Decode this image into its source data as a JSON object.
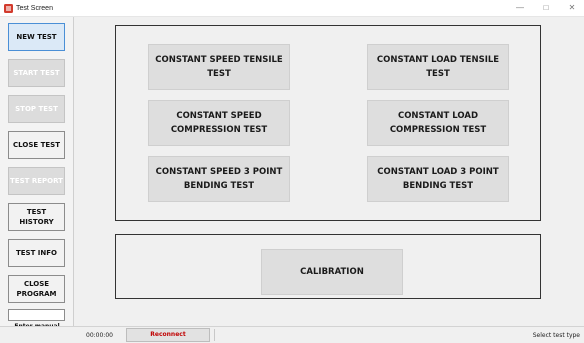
{
  "window": {
    "title": "Test Screen",
    "minimize": "—",
    "maximize": "□",
    "close": "✕"
  },
  "sidebar": {
    "new_test": "NEW TEST",
    "start_test": "START TEST",
    "stop_test": "STOP TEST",
    "close_test": "CLOSE TEST",
    "test_report": "TEST REPORT",
    "test_history": "TEST HISTORY",
    "test_info": "TEST INFO",
    "close_program": "CLOSE PROGRAM",
    "manual_input_value": "",
    "manual_label": "Enter manual"
  },
  "tests": {
    "cs_tensile": "CONSTANT SPEED TENSILE TEST",
    "cl_tensile": "CONSTANT LOAD TENSILE TEST",
    "cs_compression": "CONSTANT SPEED COMPRESSION TEST",
    "cl_compression": "CONSTANT LOAD COMPRESSION TEST",
    "cs_bending": "CONSTANT SPEED 3 POINT BENDING TEST",
    "cl_bending": "CONSTANT LOAD 3 POINT BENDING TEST"
  },
  "calibration": "CALIBRATION",
  "status": {
    "time": "00:00:00",
    "reconnect": "Reconnect",
    "hint": "Select test type"
  },
  "colors": {
    "accent": "#4a8fd6",
    "reconnect_text": "#c00000",
    "app_icon": "#d23a2c"
  }
}
